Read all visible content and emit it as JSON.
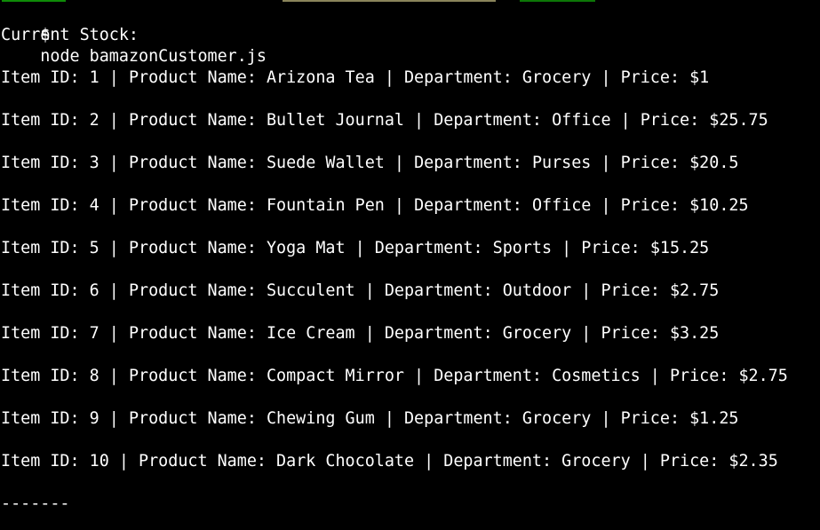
{
  "terminal": {
    "prompt_symbol": "$",
    "command": "node bamazonCustomer.js",
    "heading": "Current Stock:",
    "items": [
      {
        "id": "1",
        "name": "Arizona Tea",
        "department": "Grocery",
        "price": "$1"
      },
      {
        "id": "2",
        "name": "Bullet Journal",
        "department": "Office",
        "price": "$25.75"
      },
      {
        "id": "3",
        "name": "Suede Wallet",
        "department": "Purses",
        "price": "$20.5"
      },
      {
        "id": "4",
        "name": "Fountain Pen",
        "department": "Office",
        "price": "$10.25"
      },
      {
        "id": "5",
        "name": "Yoga Mat",
        "department": "Sports",
        "price": "$15.25"
      },
      {
        "id": "6",
        "name": "Succulent",
        "department": "Outdoor",
        "price": "$2.75"
      },
      {
        "id": "7",
        "name": "Ice Cream",
        "department": "Grocery",
        "price": "$3.25"
      },
      {
        "id": "8",
        "name": "Compact Mirror",
        "department": "Cosmetics",
        "price": "$2.75"
      },
      {
        "id": "9",
        "name": "Chewing Gum",
        "department": "Grocery",
        "price": "$1.25"
      },
      {
        "id": "10",
        "name": "Dark Chocolate",
        "department": "Grocery",
        "price": "$2.35"
      }
    ],
    "separator": "-------",
    "labels": {
      "item_id": "Item ID: ",
      "product_name": "Product Name: ",
      "department": "Department: ",
      "price": "Price: ",
      "divider": " | "
    }
  },
  "colors": {
    "background": "#000000",
    "text": "#ffffff",
    "prompt_user": "#16c60c",
    "prompt_path": "#f9f1a5",
    "prompt_branch": "#3a96dd"
  }
}
